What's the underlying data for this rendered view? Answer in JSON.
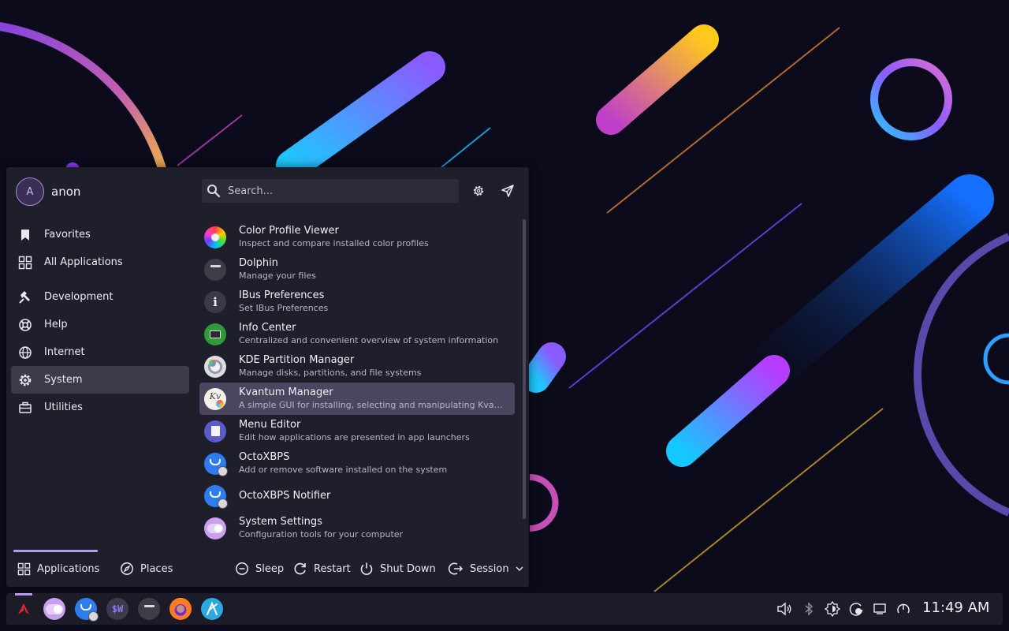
{
  "user": {
    "avatar_initial": "A",
    "name": "anon"
  },
  "search": {
    "placeholder": "Search..."
  },
  "categories": [
    {
      "label": "Favorites",
      "icon": "bookmark-icon"
    },
    {
      "label": "All Applications",
      "icon": "grid-icon"
    },
    {
      "label": "Development",
      "icon": "hammer-icon"
    },
    {
      "label": "Help",
      "icon": "lifebuoy-icon"
    },
    {
      "label": "Internet",
      "icon": "globe-icon"
    },
    {
      "label": "System",
      "icon": "gear-icon",
      "active": true
    },
    {
      "label": "Utilities",
      "icon": "toolbox-icon"
    }
  ],
  "apps": [
    {
      "name": "Color Profile Viewer",
      "desc": "Inspect and compare installed color profiles",
      "icon": "color-wheel-icon"
    },
    {
      "name": "Dolphin",
      "desc": "Manage your files",
      "icon": "folder-icon"
    },
    {
      "name": "IBus Preferences",
      "desc": "Set IBus Preferences",
      "icon": "info-icon"
    },
    {
      "name": "Info Center",
      "desc": "Centralized and convenient overview of system information",
      "icon": "circuit-board-icon"
    },
    {
      "name": "KDE Partition Manager",
      "desc": "Manage disks, partitions, and file systems",
      "icon": "disk-icon"
    },
    {
      "name": "Kvantum Manager",
      "desc": "A simple GUI for installing, selecting and manipulating Kvantum themes",
      "icon": "kvantum-icon",
      "selected": true
    },
    {
      "name": "Menu Editor",
      "desc": "Edit how applications are presented in app launchers",
      "icon": "menu-editor-icon"
    },
    {
      "name": "OctoXBPS",
      "desc": "Add or remove software installed on the system",
      "icon": "octoxbps-icon"
    },
    {
      "name": "OctoXBPS Notifier",
      "desc": "",
      "icon": "octoxbps-notifier-icon"
    },
    {
      "name": "System Settings",
      "desc": "Configuration tools for your computer",
      "icon": "settings-toggle-icon"
    }
  ],
  "footer": {
    "applications": "Applications",
    "places": "Places",
    "sleep": "Sleep",
    "restart": "Restart",
    "shutdown": "Shut Down",
    "session": "Session"
  },
  "taskbar": {
    "clock": "11:49 AM",
    "tasks": [
      "system-settings-icon",
      "octoxbps-icon",
      "terminal-icon",
      "dolphin-icon",
      "firefox-icon",
      "kate-icon"
    ],
    "tray": [
      "volume-icon",
      "bluetooth-icon",
      "brightness-icon",
      "update-icon",
      "notifications-icon",
      "power-profile-icon"
    ]
  },
  "colors": {
    "accent": "#b79be8",
    "menu_bg": "#1f1e2b",
    "selection": "#4b4560",
    "desktop": "#0c0b1c"
  }
}
